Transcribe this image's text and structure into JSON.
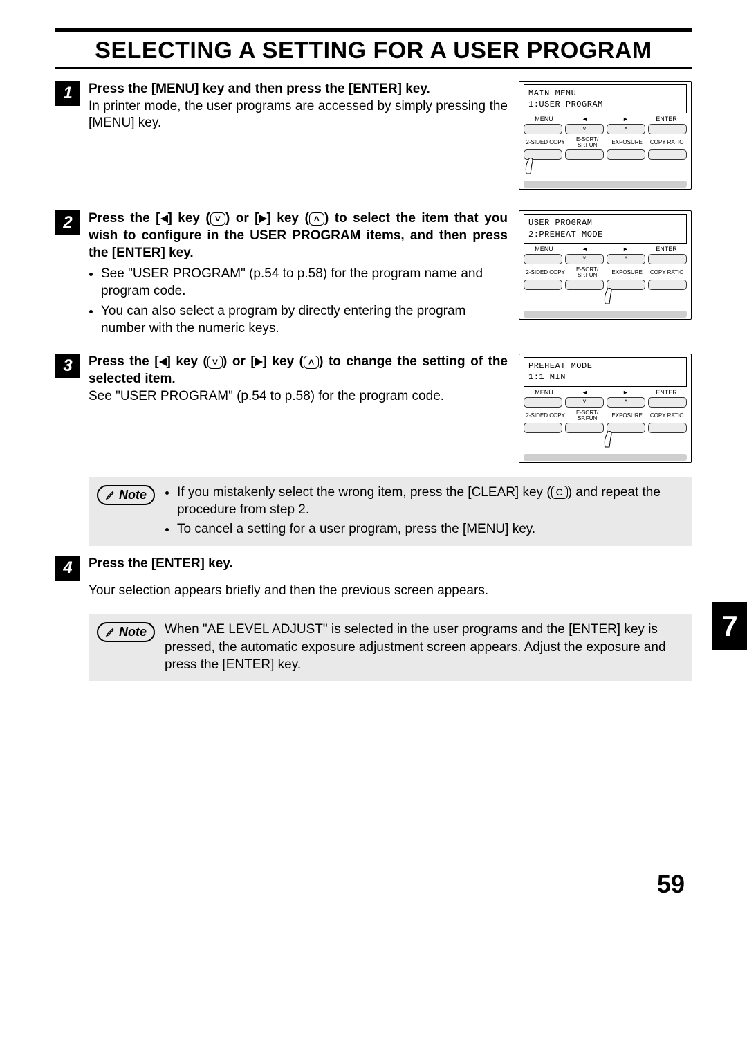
{
  "title": "SELECTING A SETTING FOR A USER PROGRAM",
  "chapter_tab": "7",
  "page_number": "59",
  "steps": [
    {
      "num": "1",
      "heading": "Press the [MENU] key and then press the [ENTER] key.",
      "body": "In printer mode, the user programs are accessed by simply pressing the [MENU] key."
    },
    {
      "num": "2",
      "heading_pre": "Press the [",
      "heading_mid1": "] key (",
      "heading_mid2": ") or [",
      "heading_mid3": "] key (",
      "heading_post": ") to select the item that you wish to configure in the USER PROGRAM items, and then press the [ENTER] key.",
      "bullets": [
        "See \"USER PROGRAM\" (p.54 to p.58) for the program name and program code.",
        "You can also select a program by directly entering the program number with the numeric keys."
      ]
    },
    {
      "num": "3",
      "heading_pre": "Press the [",
      "heading_mid1": "] key (",
      "heading_mid2": ") or [",
      "heading_mid3": "] key (",
      "heading_post": ") to change the setting of the selected item.",
      "body": "See \"USER PROGRAM\" (p.54 to p.58) for the program code."
    },
    {
      "num": "4",
      "heading": "Press the [ENTER] key.",
      "body": "Your selection appears briefly and then the previous screen appears."
    }
  ],
  "panels": [
    {
      "lcd_line1": "MAIN MENU",
      "lcd_line2": "1:USER PROGRAM",
      "row1": [
        "MENU",
        "◄",
        "►",
        "ENTER"
      ],
      "row2": [
        "",
        "˅",
        "˄",
        ""
      ],
      "row3_left": "2-SIDED COPY",
      "row3_a": "E-SORT/ SP.FUN",
      "row3_b": "EXPOSURE",
      "row3_right": "COPY RATIO",
      "hand_pos": "left"
    },
    {
      "lcd_line1": "USER PROGRAM",
      "lcd_line2": "2:PREHEAT MODE",
      "row1": [
        "MENU",
        "◄",
        "►",
        "ENTER"
      ],
      "row2": [
        "",
        "˅",
        "˄",
        ""
      ],
      "row3_left": "2-SIDED COPY",
      "row3_a": "E-SORT/ SP.FUN",
      "row3_b": "EXPOSURE",
      "row3_right": "COPY RATIO",
      "hand_pos": "mid"
    },
    {
      "lcd_line1": "PREHEAT MODE",
      "lcd_line2": "1:1 MIN",
      "row1": [
        "MENU",
        "◄",
        "►",
        "ENTER"
      ],
      "row2": [
        "",
        "˅",
        "˄",
        ""
      ],
      "row3_left": "2-SIDED COPY",
      "row3_a": "E-SORT/ SP.FUN",
      "row3_b": "EXPOSURE",
      "row3_right": "COPY RATIO",
      "hand_pos": "mid"
    }
  ],
  "notes": [
    {
      "label": "Note",
      "bullets": [
        "If you mistakenly select the wrong item, press the [CLEAR] key ( C ) and repeat the procedure from step 2.",
        "To cancel a setting for a user program, press the [MENU] key."
      ]
    },
    {
      "label": "Note",
      "text": "When \"AE LEVEL ADJUST\" is selected in the user programs and the [ENTER] key is pressed, the automatic exposure adjustment screen appears. Adjust the exposure and press the [ENTER] key."
    }
  ]
}
